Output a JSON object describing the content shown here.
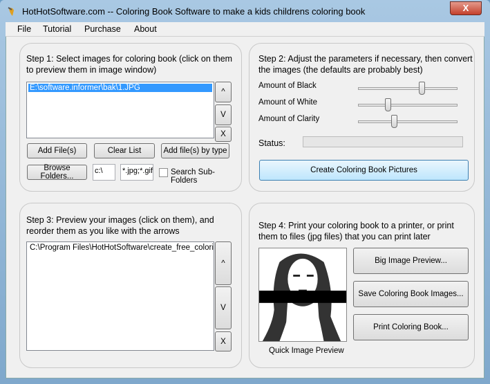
{
  "window": {
    "title": "HotHotSoftware.com -- Coloring Book Software to make a kids childrens coloring book",
    "close": "X"
  },
  "menu": [
    "File",
    "Tutorial",
    "Purchase",
    "About"
  ],
  "step1": {
    "text": "Step 1: Select images for coloring book (click on them to preview them in image window)",
    "list_items": [
      "E:\\software.informer\\bak\\1.JPG"
    ],
    "up": "^",
    "down": "V",
    "remove": "X",
    "add_files": "Add File(s)",
    "clear_list": "Clear List",
    "add_by_type": "Add file(s) by type",
    "browse": "Browse Folders...",
    "folder_value": "c:\\",
    "filter_value": "*.jpg;*.gif",
    "search_sub": "Search Sub-Folders",
    "search_sub_checked": false
  },
  "step2": {
    "text": "Step 2: Adjust the parameters if necessary, then convert the images (the defaults are probably best)",
    "sliders": [
      {
        "label": "Amount of Black",
        "value": 0.65
      },
      {
        "label": "Amount of White",
        "value": 0.28
      },
      {
        "label": "Amount of Clarity",
        "value": 0.35
      }
    ],
    "status_label": "Status:",
    "status_progress": 0,
    "create": "Create Coloring Book Pictures"
  },
  "step3": {
    "text": "Step 3: Preview your images (click on them), and reorder them as you like with the arrows",
    "list_items": [
      "C:\\Program Files\\HotHotSoftware\\create_free_coloring_"
    ],
    "up": "^",
    "down": "V",
    "remove": "X"
  },
  "step4": {
    "text": "Step 4: Print your coloring book to a printer, or print them to files (jpg files) that you can print later",
    "preview_caption": "Quick Image Preview",
    "big_preview": "Big Image Preview...",
    "save": "Save Coloring Book Images...",
    "print": "Print Coloring Book..."
  }
}
